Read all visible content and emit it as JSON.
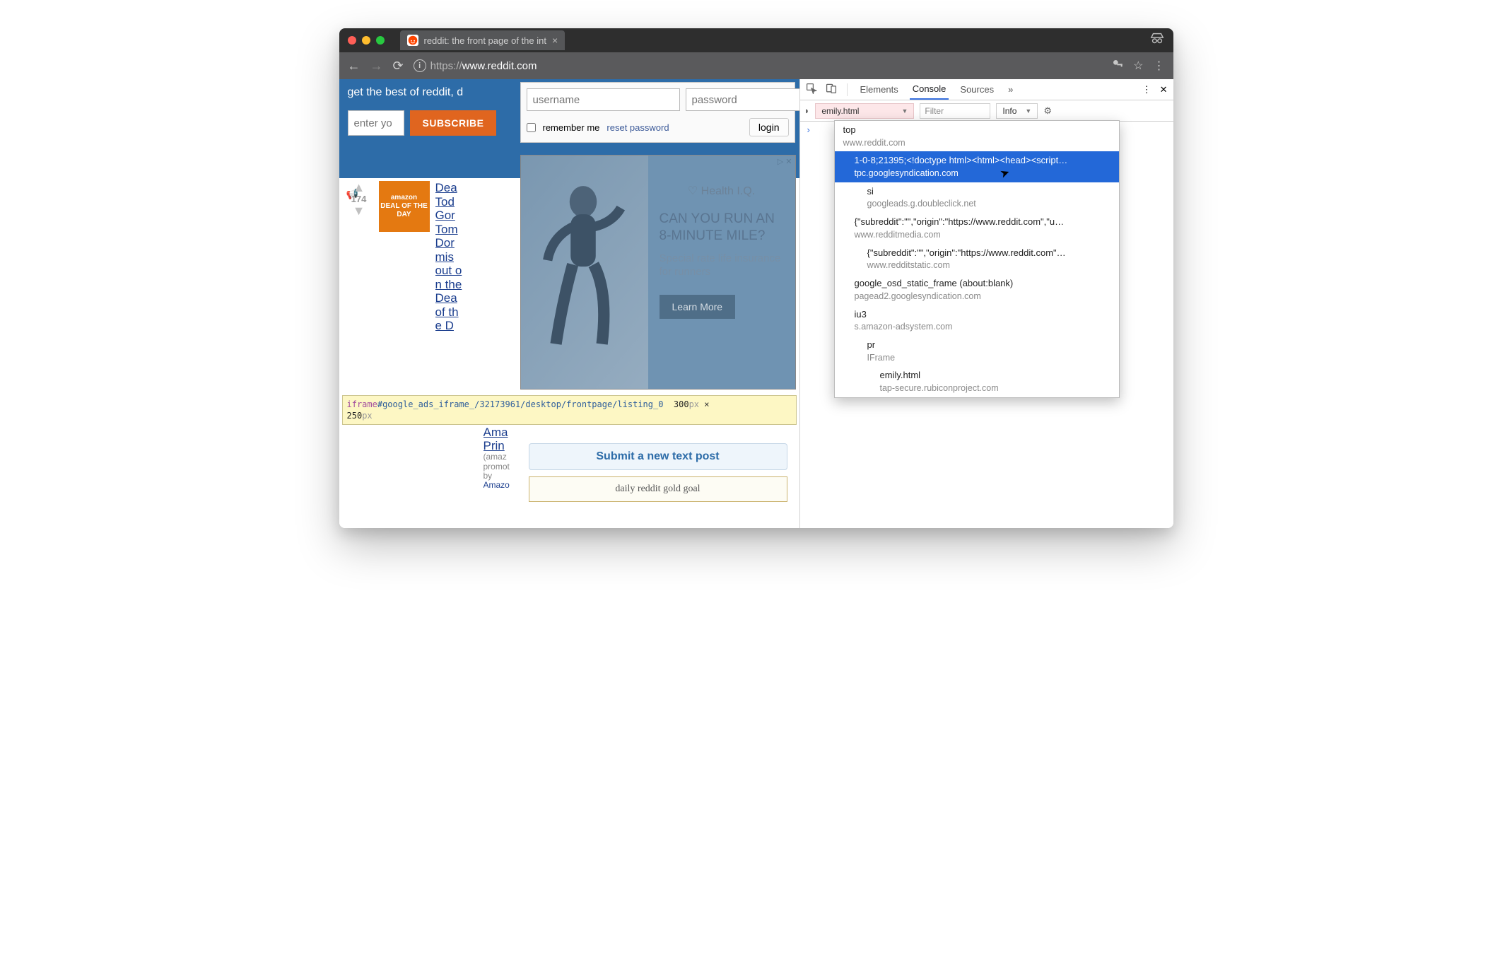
{
  "window": {
    "tab_title": "reddit: the front page of the int",
    "url_prefix": "https://",
    "url_host": "www.reddit.com"
  },
  "blue_banner": "get the best of reddit, d",
  "email_placeholder": "enter yo",
  "subscribe_label": "SUBSCRIBE",
  "login": {
    "username_ph": "username",
    "password_ph": "password",
    "remember": "remember me",
    "reset": "reset password",
    "login_btn": "login"
  },
  "ad": {
    "brand": "♡ Health I.Q.",
    "headline": "CAN YOU RUN AN 8-MINUTE MILE?",
    "sub": "Special rate life insurance for runners",
    "cta": "Learn More"
  },
  "post": {
    "score": "174",
    "thumb1": "amazon",
    "thumb2": "DEAL OF THE DAY",
    "title_frag": "Dea Tod Gor Tom Dor mis out on the Dea of the D",
    "prime_title": "Ama Prin",
    "prime_meta1": "(amaz",
    "prime_meta2": "promot",
    "prime_meta3": "by",
    "prime_src": "Amazo"
  },
  "tooltip": {
    "tag": "iframe",
    "selector": "#google_ads_iframe_/32173961/desktop/frontpage/listing_0",
    "w": "300",
    "h": "250",
    "px": "px",
    "times": " × "
  },
  "submit_label": "Submit a new text post",
  "gold_label": "daily reddit gold goal",
  "devtools": {
    "tabs": {
      "elements": "Elements",
      "console": "Console",
      "sources": "Sources"
    },
    "context_selected": "emily.html",
    "filter_ph": "Filter",
    "level": "Info",
    "frames": [
      {
        "name": "top",
        "host": "www.reddit.com",
        "indent": 0
      },
      {
        "name": "1-0-8;21395;<!doctype html><html><head><script…",
        "host": "tpc.googlesyndication.com",
        "indent": 1,
        "sel": true
      },
      {
        "name": "si",
        "host": "googleads.g.doubleclick.net",
        "indent": 2
      },
      {
        "name": "{\"subreddit\":\"\",\"origin\":\"https://www.reddit.com\",\"u…",
        "host": "www.redditmedia.com",
        "indent": 1
      },
      {
        "name": "{\"subreddit\":\"\",\"origin\":\"https://www.reddit.com\"…",
        "host": "www.redditstatic.com",
        "indent": 2
      },
      {
        "name": "google_osd_static_frame (about:blank)",
        "host": "pagead2.googlesyndication.com",
        "indent": 1
      },
      {
        "name": "iu3",
        "host": "s.amazon-adsystem.com",
        "indent": 1
      },
      {
        "name": "pr",
        "host": "IFrame",
        "indent": 2
      },
      {
        "name": "emily.html",
        "host": "tap-secure.rubiconproject.com",
        "indent": 3
      }
    ]
  }
}
